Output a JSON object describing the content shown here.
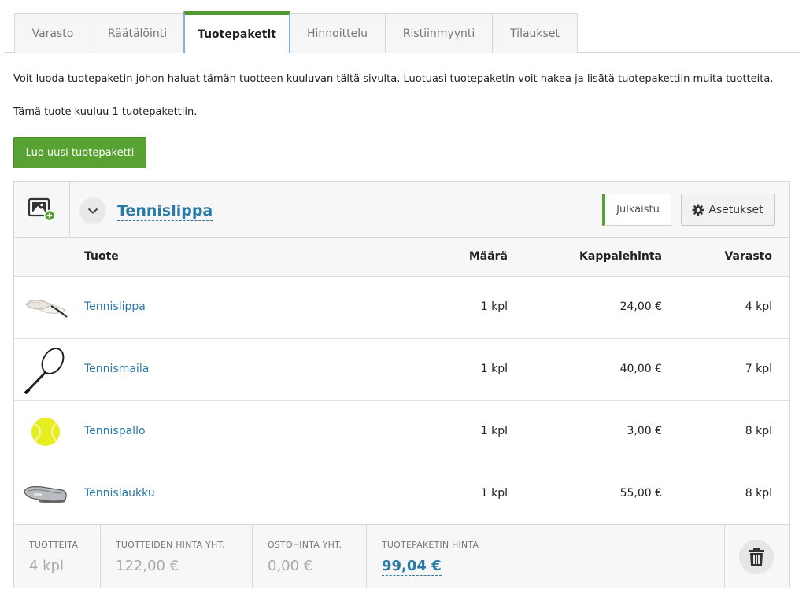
{
  "tabs": [
    {
      "label": "Varasto"
    },
    {
      "label": "Räätälöinti"
    },
    {
      "label": "Tuotepaketit",
      "active": true
    },
    {
      "label": "Hinnoittelu"
    },
    {
      "label": "Ristiinmyynti"
    },
    {
      "label": "Tilaukset"
    }
  ],
  "intro_text": "Voit luoda tuotepaketin johon haluat tämän tuotteen kuuluvan tältä sivulta. Luotuasi tuotepaketin voit hakea ja lisätä tuotepakettiin muita tuotteita.",
  "membership_text": "Tämä tuote kuuluu 1 tuotepakettiin.",
  "create_button": "Luo uusi tuotepaketti",
  "bundle": {
    "title": "Tennislippa",
    "published_label": "Julkaistu",
    "settings_label": "Asetukset",
    "columns": {
      "product": "Tuote",
      "quantity": "Määrä",
      "unit_price": "Kappalehinta",
      "stock": "Varasto"
    },
    "items": [
      {
        "name": "Tennislippa",
        "quantity": "1 kpl",
        "unit_price": "24,00 €",
        "stock": "4 kpl",
        "icon": "visor-cap-icon"
      },
      {
        "name": "Tennismaila",
        "quantity": "1 kpl",
        "unit_price": "40,00 €",
        "stock": "7 kpl",
        "icon": "tennis-racket-icon"
      },
      {
        "name": "Tennispallo",
        "quantity": "1 kpl",
        "unit_price": "3,00 €",
        "stock": "8 kpl",
        "icon": "tennis-ball-icon"
      },
      {
        "name": "Tennislaukku",
        "quantity": "1 kpl",
        "unit_price": "55,00 €",
        "stock": "8 kpl",
        "icon": "tennis-bag-icon"
      }
    ],
    "summary": {
      "products_label": "TUOTTEITA",
      "products_value": "4 kpl",
      "products_total_label": "TUOTTEIDEN HINTA YHT.",
      "products_total_value": "122,00 €",
      "purchase_total_label": "OSTOHINTA YHT.",
      "purchase_total_value": "0,00 €",
      "bundle_price_label": "TUOTEPAKETIN HINTA",
      "bundle_price_value": "99,04 €"
    }
  },
  "colors": {
    "accent_green": "#58a233",
    "link_blue": "#2a7aa8",
    "active_tab_outline": "#7fb0e6"
  }
}
